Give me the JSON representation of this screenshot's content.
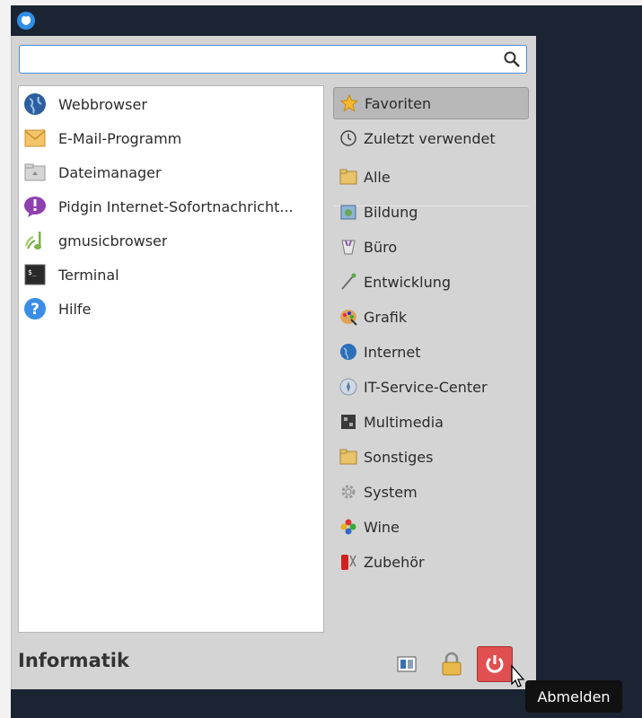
{
  "search": {
    "value": "",
    "placeholder": ""
  },
  "apps": [
    {
      "label": "Webbrowser",
      "icon": "globe-icon"
    },
    {
      "label": "E-Mail-Programm",
      "icon": "mail-icon"
    },
    {
      "label": "Dateimanager",
      "icon": "folder-home-icon"
    },
    {
      "label": "Pidgin Internet-Sofortnachricht...",
      "icon": "pidgin-icon"
    },
    {
      "label": "gmusicbrowser",
      "icon": "music-note-icon"
    },
    {
      "label": "Terminal",
      "icon": "terminal-icon"
    },
    {
      "label": "Hilfe",
      "icon": "help-icon"
    }
  ],
  "categories": [
    {
      "label": "Favoriten",
      "icon": "star-icon",
      "active": true
    },
    {
      "label": "Zuletzt verwendet",
      "icon": "history-icon"
    },
    {
      "label": "Alle",
      "icon": "folder-icon"
    },
    {
      "label": "Bildung",
      "icon": "education-icon"
    },
    {
      "label": "Büro",
      "icon": "office-icon"
    },
    {
      "label": "Entwicklung",
      "icon": "development-icon"
    },
    {
      "label": "Grafik",
      "icon": "palette-icon"
    },
    {
      "label": "Internet",
      "icon": "globe-icon"
    },
    {
      "label": "IT-Service-Center",
      "icon": "service-icon"
    },
    {
      "label": "Multimedia",
      "icon": "multimedia-icon"
    },
    {
      "label": "Sonstiges",
      "icon": "folder-icon"
    },
    {
      "label": "System",
      "icon": "gear-icon"
    },
    {
      "label": "Wine",
      "icon": "wine-icon"
    },
    {
      "label": "Zubehör",
      "icon": "accessories-icon"
    }
  ],
  "footer": {
    "username": "Informatik",
    "tooltip": "Abmelden"
  },
  "colors": {
    "panel": "#1b2432",
    "logout": "#e05050",
    "active_category": "#b8b8b8"
  }
}
